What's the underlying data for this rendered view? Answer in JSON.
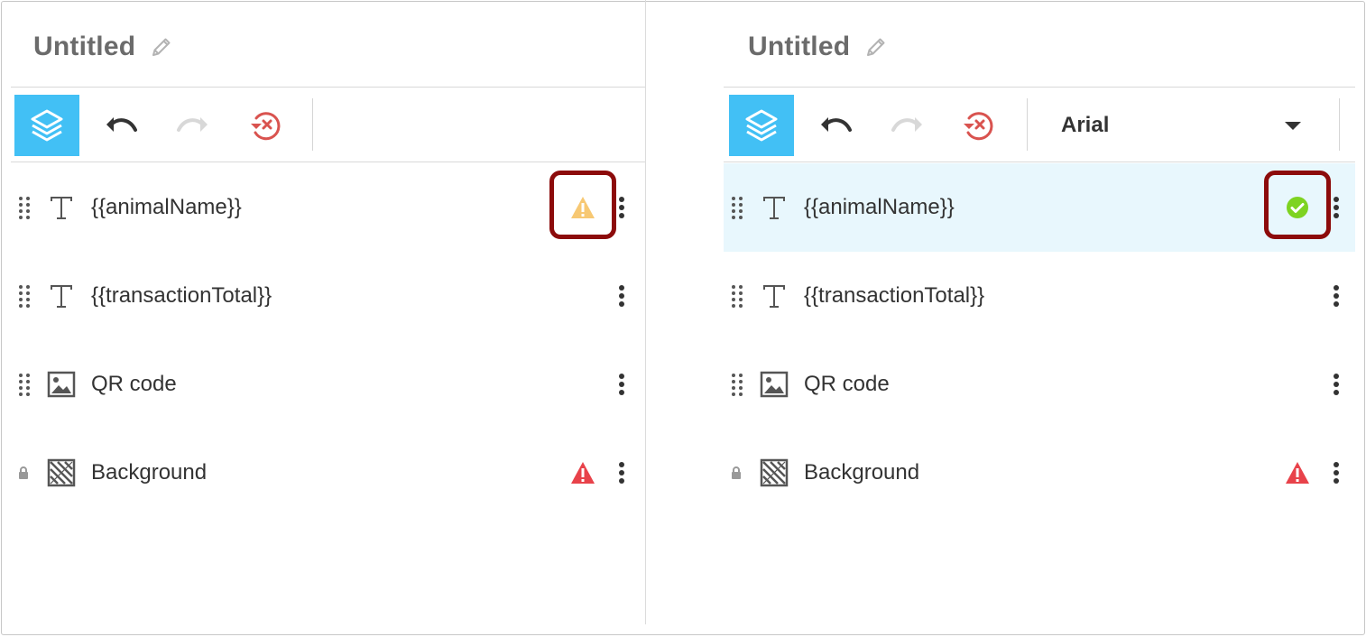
{
  "panels": [
    {
      "title": "Untitled",
      "toolbar": {
        "buttons": [
          {
            "icon": "layers-icon",
            "active": true
          },
          {
            "icon": "undo-icon",
            "enabled": true
          },
          {
            "icon": "redo-icon",
            "enabled": false
          },
          {
            "icon": "revert-icon",
            "enabled": true
          }
        ]
      },
      "layers": [
        {
          "label": "{{animalName}}",
          "type": "text",
          "status": "warning-yellow",
          "highlighted": true
        },
        {
          "label": "{{transactionTotal}}",
          "type": "text",
          "status": "none"
        },
        {
          "label": "QR code",
          "type": "image",
          "status": "none"
        },
        {
          "label": "Background",
          "type": "background",
          "status": "error-red",
          "locked": true
        }
      ]
    },
    {
      "title": "Untitled",
      "toolbar": {
        "buttons": [
          {
            "icon": "layers-icon",
            "active": true
          },
          {
            "icon": "undo-icon",
            "enabled": true
          },
          {
            "icon": "redo-icon",
            "enabled": false
          },
          {
            "icon": "revert-icon",
            "enabled": true
          }
        ],
        "font": {
          "selected": "Arial"
        }
      },
      "layers": [
        {
          "label": "{{animalName}}",
          "type": "text",
          "status": "ok-green",
          "highlighted": true,
          "selected": true
        },
        {
          "label": "{{transactionTotal}}",
          "type": "text",
          "status": "none"
        },
        {
          "label": "QR code",
          "type": "image",
          "status": "none"
        },
        {
          "label": "Background",
          "type": "background",
          "status": "error-red",
          "locked": true
        }
      ]
    }
  ],
  "colors": {
    "accent": "#42c0f5",
    "warning": "#f7c873",
    "error": "#e8424a",
    "ok": "#7ed321",
    "highlight": "#8c0b0b",
    "revert": "#d9534f"
  }
}
